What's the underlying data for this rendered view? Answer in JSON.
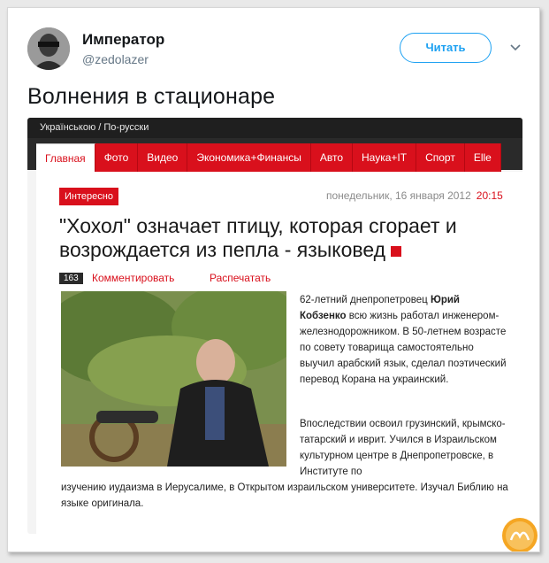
{
  "tweet": {
    "display_name": "Император",
    "handle": "@zedolazer",
    "follow_label": "Читать",
    "text": "Волнения в стационаре"
  },
  "embedded_site": {
    "language_switch": "Українською / По-русски",
    "nav_items": [
      "Главная",
      "Фото",
      "Видео",
      "Экономика+Финансы",
      "Авто",
      "Наука+IT",
      "Спорт",
      "Elle"
    ],
    "badge": "Интересно",
    "date": "понедельник, 16 января 2012",
    "time": "20:15",
    "headline": "\"Хохол\" означает птицу, которая сгорает и возрождается из пепла - языковед",
    "comment_count": "163",
    "comment_link": "Комментировать",
    "print_link": "Распечатать",
    "para1_start": "62-летний днепропетровец ",
    "para1_bold": "Юрий Кобзенко",
    "para1_rest": " всю жизнь работал инженером-железнодорожником. В 50-летнем возрасте по совету товарища самостоятельно выучил арабский язык, сделал поэтический перевод Корана на украинский.",
    "para2": "Впоследствии освоил грузинский, крымско-татарский и иврит. Учился в Израильском культурном центре в Днепропетровске, в Институте по",
    "para3": "изучению иудаизма в Иерусалиме, в Открытом израильском университете. Изучал Библию на языке оригинала."
  },
  "colors": {
    "accent_red": "#d9101c",
    "twitter_blue": "#1da1f2"
  }
}
